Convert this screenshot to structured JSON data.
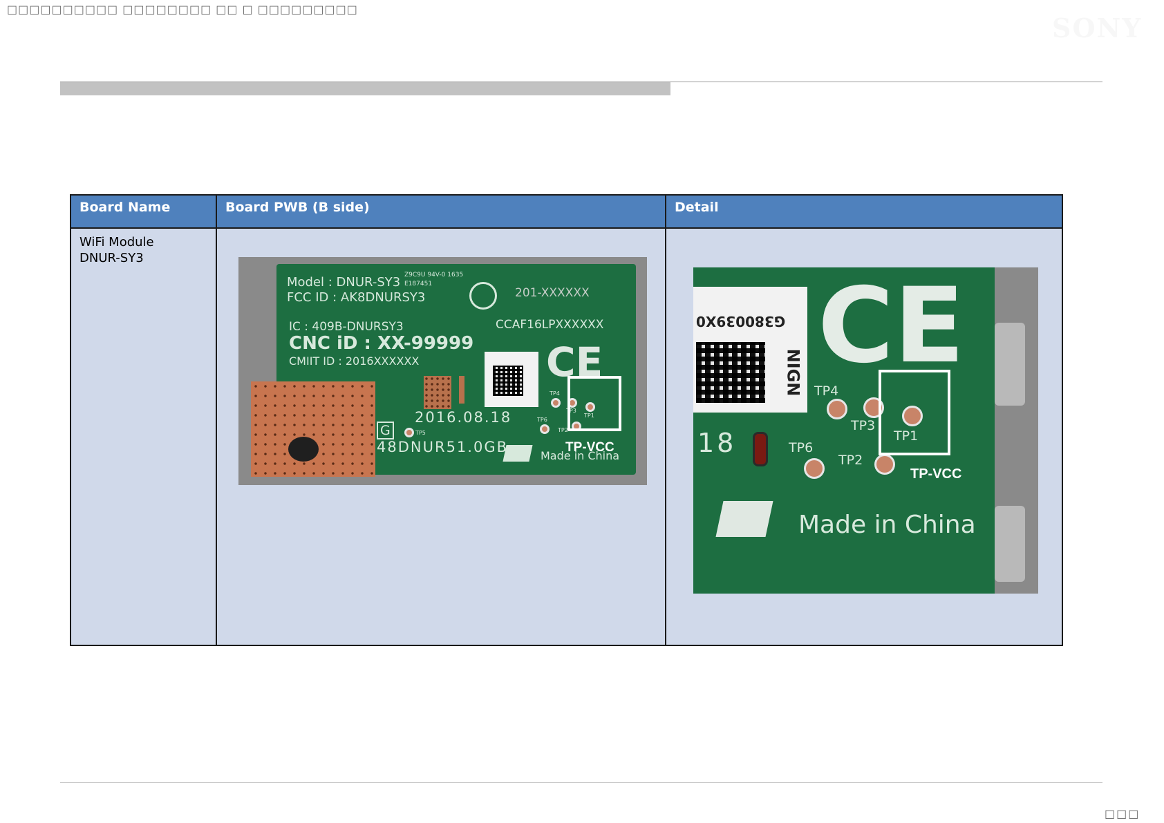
{
  "header": {
    "doc_ref": "□□□□□□□□□□ □□□□□□□□ □□ □ □□□□□□□□□",
    "logo": "SONY"
  },
  "table": {
    "headers": [
      "Board Name",
      "Board PWB  (B side)",
      "Detail"
    ],
    "board_name_lines": [
      "WiFi Module",
      "DNUR-SY3"
    ]
  },
  "pwb_photo": {
    "label_model": "Model : DNUR-SY3",
    "label_fcc": "FCC ID : AK8DNURSY3",
    "label_cert_small": "Z9C9U 94V-0 1635 E187451",
    "label_r": "201-XXXXXX",
    "label_ic": "IC : 409B-DNURSY3",
    "label_cnc": "CNC iD : XX-99999",
    "label_ccaf": "CCAF16LPXXXXXX",
    "label_cmiit": "CMIIT ID : 2016XXXXXX",
    "label_date": "2016.08.18",
    "label_g": "G",
    "label_code": "48DNUR51.0GB",
    "label_made": "Made in China",
    "label_ce": "CE",
    "tp_labels": [
      "TP4",
      "TP3",
      "TP1",
      "TP6",
      "TP2",
      "TP5"
    ],
    "callout": "TP-VCC"
  },
  "detail_photo": {
    "label_ce": "CE",
    "label_qr_code": "G380039X0",
    "label_nign": "NIGN",
    "tp_labels": [
      "TP4",
      "TP3",
      "TP1",
      "TP6",
      "TP2"
    ],
    "label_18": "18",
    "label_made": "Made in China",
    "callout": "TP-VCC"
  },
  "footer": {
    "page_number": "□□□ □□□"
  },
  "colors": {
    "header_bg": "#4f81bd",
    "cell_bg": "#d0d9ea",
    "pcb_green": "#1d6e41",
    "title_bar": "#c2c2c2"
  }
}
